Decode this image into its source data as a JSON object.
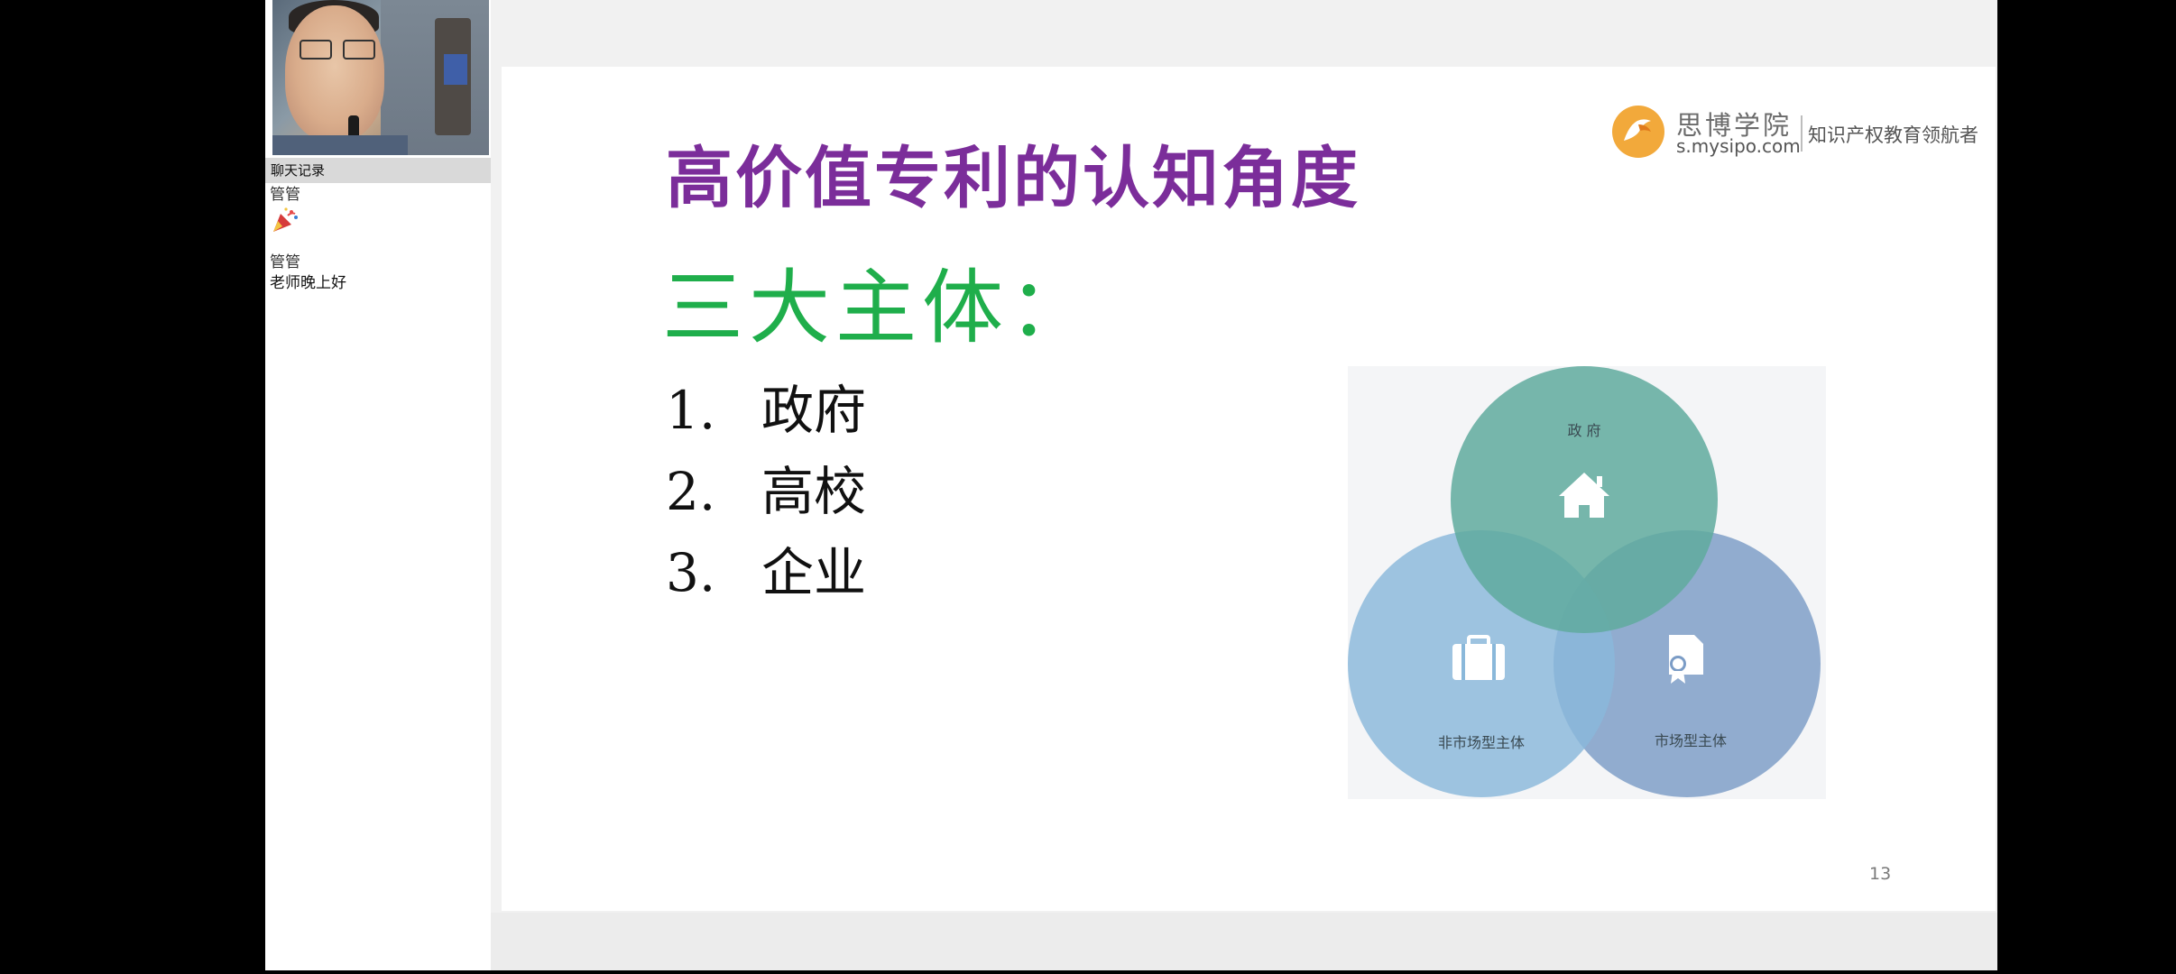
{
  "chat": {
    "header": "聊天记录",
    "messages": [
      {
        "sender": "管管",
        "content_icon": "party-popper-icon",
        "text": ""
      },
      {
        "sender": "管管",
        "text": "老师晚上好"
      }
    ]
  },
  "slide": {
    "title": "高价值专利的认知角度",
    "subtitle": "三大主体：",
    "list": [
      {
        "num": "1.",
        "text": "政府"
      },
      {
        "num": "2.",
        "text": "高校"
      },
      {
        "num": "3.",
        "text": "企业"
      }
    ],
    "logo": {
      "name": "思博学院",
      "url": "s.mysipo.com",
      "tagline": "知识产权教育领航者"
    },
    "diagram": {
      "circles": [
        {
          "label": "政 府",
          "icon": "house-icon",
          "color": "#5faa9e"
        },
        {
          "label": "非市场型主体",
          "icon": "briefcase-icon",
          "color": "#8ab8da"
        },
        {
          "label": "市场型主体",
          "icon": "certificate-icon",
          "color": "#7b9cc6"
        }
      ]
    },
    "page_number": "13"
  },
  "colors": {
    "title": "#7b2d9a",
    "subtitle": "#1fae4b",
    "logo_accent": "#f2a93b"
  }
}
